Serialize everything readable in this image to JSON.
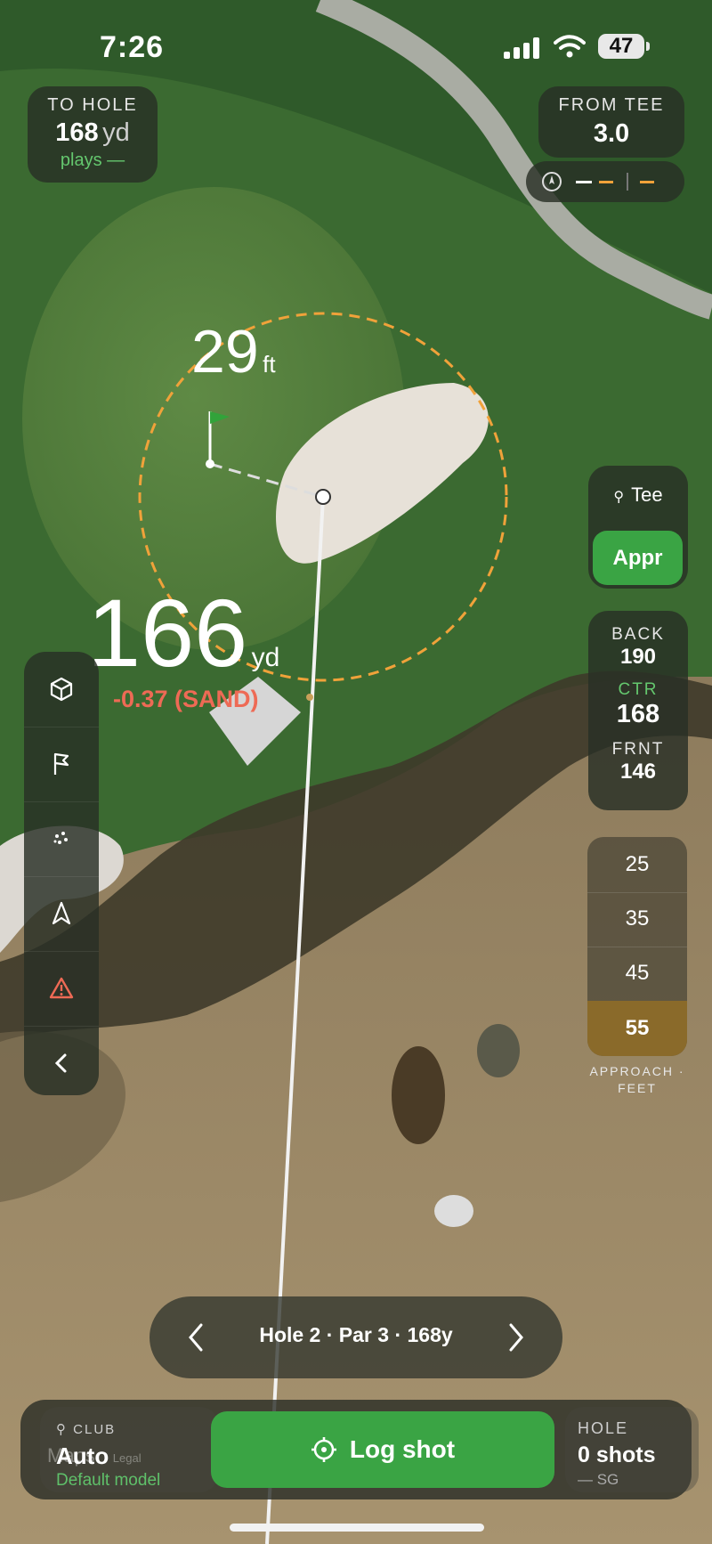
{
  "status_bar": {
    "time": "7:26",
    "battery": "47"
  },
  "to_hole": {
    "label": "TO HOLE",
    "value": "168",
    "unit": "yd",
    "plays": "plays —"
  },
  "from_tee": {
    "label": "FROM TEE",
    "value": "3.0"
  },
  "compass_legend": {
    "icon": "compass-icon",
    "items": [
      "white-dash",
      "orange-dash",
      "orange-dash"
    ]
  },
  "map_overlay": {
    "pin_distance_value": "29",
    "pin_distance_unit": "ft",
    "shot_distance_value": "166",
    "shot_distance_unit": "yd",
    "shot_delta": "-0.37 (SAND)",
    "maps_credit": "Maps",
    "legal": "Legal"
  },
  "mode_toggle": {
    "tee_label": "Tee",
    "approach_label": "Appr"
  },
  "green_distances": [
    {
      "label": "BACK",
      "value": "190"
    },
    {
      "label": "CTR",
      "value": "168"
    },
    {
      "label": "FRNT",
      "value": "146"
    }
  ],
  "approach_zones": {
    "values": [
      "25",
      "35",
      "45",
      "55"
    ],
    "selected": "55",
    "caption_line1": "APPROACH ·",
    "caption_line2": "FEET"
  },
  "tools": [
    "cube-icon",
    "flag-icon",
    "dispersion-icon",
    "navigation-icon",
    "hazard-icon",
    "chevron-left-icon"
  ],
  "hole_nav": {
    "label": "Hole 2 · Par 3 · 168y"
  },
  "bottom_bar": {
    "club_label": "CLUB",
    "club_value": "Auto",
    "club_model": "Default model",
    "log_button": "Log shot",
    "hole_label": "HOLE",
    "hole_value": "0 shots",
    "hole_sg": "— SG"
  },
  "colors": {
    "accent_green": "#3aa444",
    "warn_red": "#ee6a55",
    "zone_orange": "#8a6a2a",
    "dashed_orange": "#f0a23a"
  }
}
